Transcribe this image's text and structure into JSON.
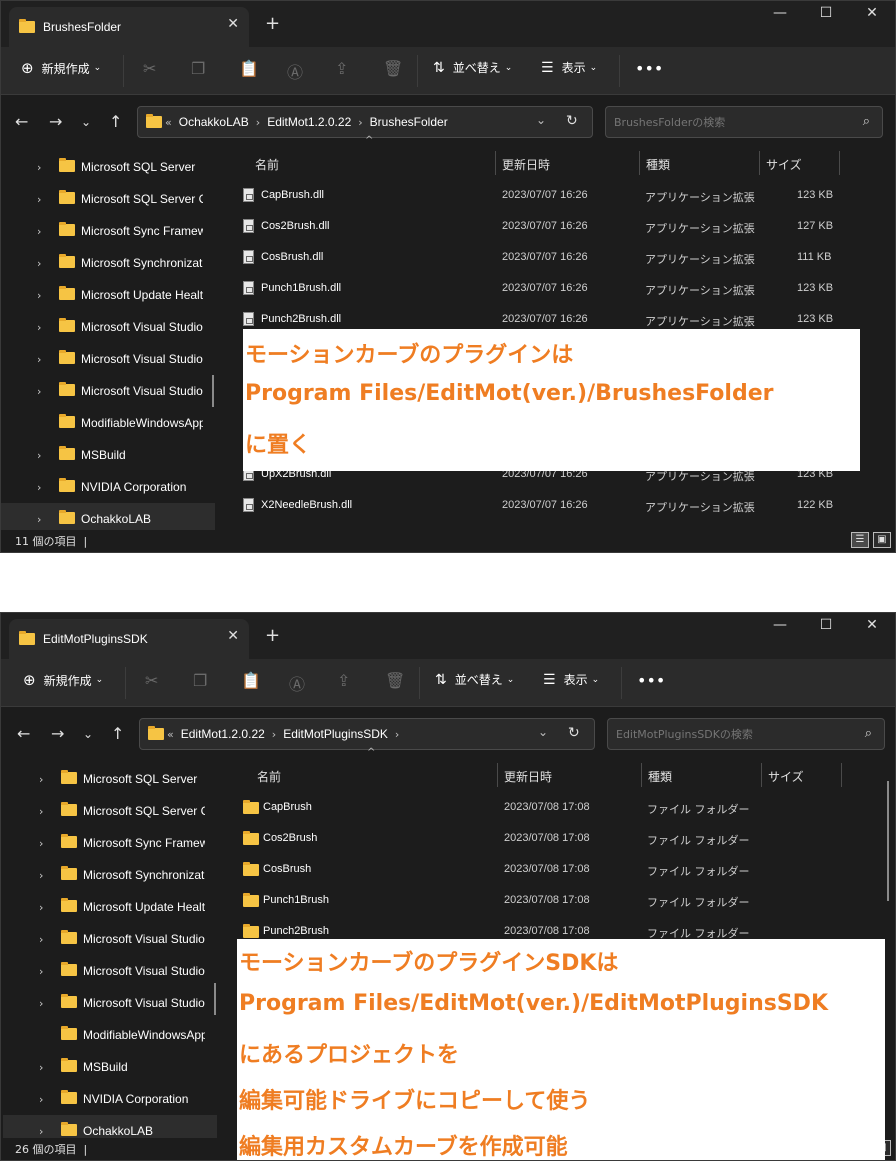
{
  "colors": {
    "accent": "#ef7d22",
    "folder": "#f6c444",
    "bg": "#1c1c1c"
  },
  "win1": {
    "tab_title": "BrushesFolder",
    "toolbar": {
      "new": "新規作成",
      "sort": "並べ替え",
      "view": "表示"
    },
    "breadcrumb": [
      "EditMot1.2.0.22",
      "BrushesFolder"
    ],
    "breadcrumb_root": "OchakkoLAB",
    "search_placeholder": "BrushesFolderの検索",
    "sidebar": [
      "Microsoft SQL Server",
      "Microsoft SQL Server Co",
      "Microsoft Sync Framew",
      "Microsoft Synchronizat",
      "Microsoft Update Healt",
      "Microsoft Visual Studio",
      "Microsoft Visual Studio",
      "Microsoft Visual Studio",
      "ModifiableWindowsApp",
      "MSBuild",
      "NVIDIA Corporation",
      "OchakkoLAB"
    ],
    "columns": {
      "name": "名前",
      "date": "更新日時",
      "type": "種類",
      "size": "サイズ"
    },
    "files": [
      {
        "name": "CapBrush.dll",
        "date": "2023/07/07 16:26",
        "type": "アプリケーション拡張",
        "size": "123 KB"
      },
      {
        "name": "Cos2Brush.dll",
        "date": "2023/07/07 16:26",
        "type": "アプリケーション拡張",
        "size": "127 KB"
      },
      {
        "name": "CosBrush.dll",
        "date": "2023/07/07 16:26",
        "type": "アプリケーション拡張",
        "size": "111 KB"
      },
      {
        "name": "Punch1Brush.dll",
        "date": "2023/07/07 16:26",
        "type": "アプリケーション拡張",
        "size": "123 KB"
      },
      {
        "name": "Punch2Brush.dll",
        "date": "2023/07/07 16:26",
        "type": "アプリケーション拡張",
        "size": "123 KB"
      },
      {
        "name": "UpX2Brush.dll",
        "date": "2023/07/07 16:26",
        "type": "アプリケーション拡張",
        "size": "123 KB"
      },
      {
        "name": "X2NeedleBrush.dll",
        "date": "2023/07/07 16:26",
        "type": "アプリケーション拡張",
        "size": "122 KB"
      }
    ],
    "status": "11 個の項目",
    "overlay": [
      "モーションカーブのプラグインは",
      "Program Files/EditMot(ver.)/BrushesFolder",
      "に置く"
    ]
  },
  "win2": {
    "tab_title": "EditMotPluginsSDK",
    "toolbar": {
      "new": "新規作成",
      "sort": "並べ替え",
      "view": "表示"
    },
    "breadcrumb": [
      "EditMot1.2.0.22",
      "EditMotPluginsSDK"
    ],
    "search_placeholder": "EditMotPluginsSDKの検索",
    "sidebar": [
      "Microsoft SQL Server",
      "Microsoft SQL Server Co",
      "Microsoft Sync Framew",
      "Microsoft Synchronizat",
      "Microsoft Update Healt",
      "Microsoft Visual Studio",
      "Microsoft Visual Studio",
      "Microsoft Visual Studio",
      "ModifiableWindowsApp",
      "MSBuild",
      "NVIDIA Corporation",
      "OchakkoLAB"
    ],
    "columns": {
      "name": "名前",
      "date": "更新日時",
      "type": "種類",
      "size": "サイズ"
    },
    "files": [
      {
        "name": "CapBrush",
        "date": "2023/07/08 17:08",
        "type": "ファイル フォルダー",
        "size": ""
      },
      {
        "name": "Cos2Brush",
        "date": "2023/07/08 17:08",
        "type": "ファイル フォルダー",
        "size": ""
      },
      {
        "name": "CosBrush",
        "date": "2023/07/08 17:08",
        "type": "ファイル フォルダー",
        "size": ""
      },
      {
        "name": "Punch1Brush",
        "date": "2023/07/08 17:08",
        "type": "ファイル フォルダー",
        "size": ""
      },
      {
        "name": "Punch2Brush",
        "date": "2023/07/08 17:08",
        "type": "ファイル フォルダー",
        "size": ""
      }
    ],
    "status": "26 個の項目",
    "overlay": [
      "モーションカーブのプラグインSDKは",
      "Program Files/EditMot(ver.)/EditMotPluginsSDK",
      "にあるプロジェクトを",
      "編集可能ドライブにコピーして使う",
      "編集用カスタムカーブを作成可能"
    ]
  }
}
